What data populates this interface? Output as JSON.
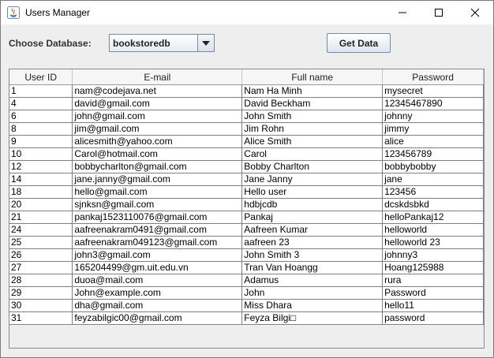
{
  "window": {
    "title": "Users Manager"
  },
  "controls": {
    "choose_label": "Choose Database:",
    "database_selected": "bookstoredb",
    "get_data_label": "Get Data"
  },
  "table": {
    "columns": [
      "User ID",
      "E-mail",
      "Full name",
      "Password"
    ],
    "rows": [
      [
        "1",
        "nam@codejava.net",
        "Nam Ha Minh",
        "mysecret"
      ],
      [
        "4",
        "david@gmail.com",
        "David Beckham",
        "12345467890"
      ],
      [
        "6",
        "john@gmail.com",
        "John Smith",
        "johnny"
      ],
      [
        "8",
        "jim@gmail.com",
        "Jim Rohn",
        "jimmy"
      ],
      [
        "9",
        "alicesmith@yahoo.com",
        "Alice Smith",
        "alice"
      ],
      [
        "10",
        "Carol@hotmail.com",
        "Carol",
        "123456789"
      ],
      [
        "12",
        "bobbycharlton@gmail.com",
        "Bobby Charlton",
        "bobbybobby"
      ],
      [
        "14",
        "jane.janny@gmail.com",
        "Jane Janny",
        "jane"
      ],
      [
        "18",
        "hello@gmail.com",
        "Hello user",
        "123456"
      ],
      [
        "20",
        "sjnksn@gmail.com",
        "hdbjcdb",
        "dcskdsbkd"
      ],
      [
        "21",
        "pankaj1523110076@gmail.com",
        "Pankaj",
        "helloPankaj12"
      ],
      [
        "24",
        "aafreenakram0491@gmail.com",
        "Aafreen Kumar",
        "helloworld"
      ],
      [
        "25",
        "aafreenakram049123@gmail.com",
        "aafreen 23",
        "helloworld 23"
      ],
      [
        "26",
        "john3@gmail.com",
        "John Smith 3",
        "johnny3"
      ],
      [
        "27",
        "165204499@gm.uit.edu.vn",
        "Tran Van Hoangg",
        "Hoang125988"
      ],
      [
        "28",
        "duoa@mail.com",
        "Adamus",
        "rura"
      ],
      [
        "29",
        "John@example.com",
        "John",
        "Password"
      ],
      [
        "30",
        "dha@gmail.com",
        "Miss Dhara",
        "hello11"
      ],
      [
        "31",
        "feyzabilgic00@gmail.com",
        "Feyza Bilgi□",
        "password"
      ]
    ]
  }
}
